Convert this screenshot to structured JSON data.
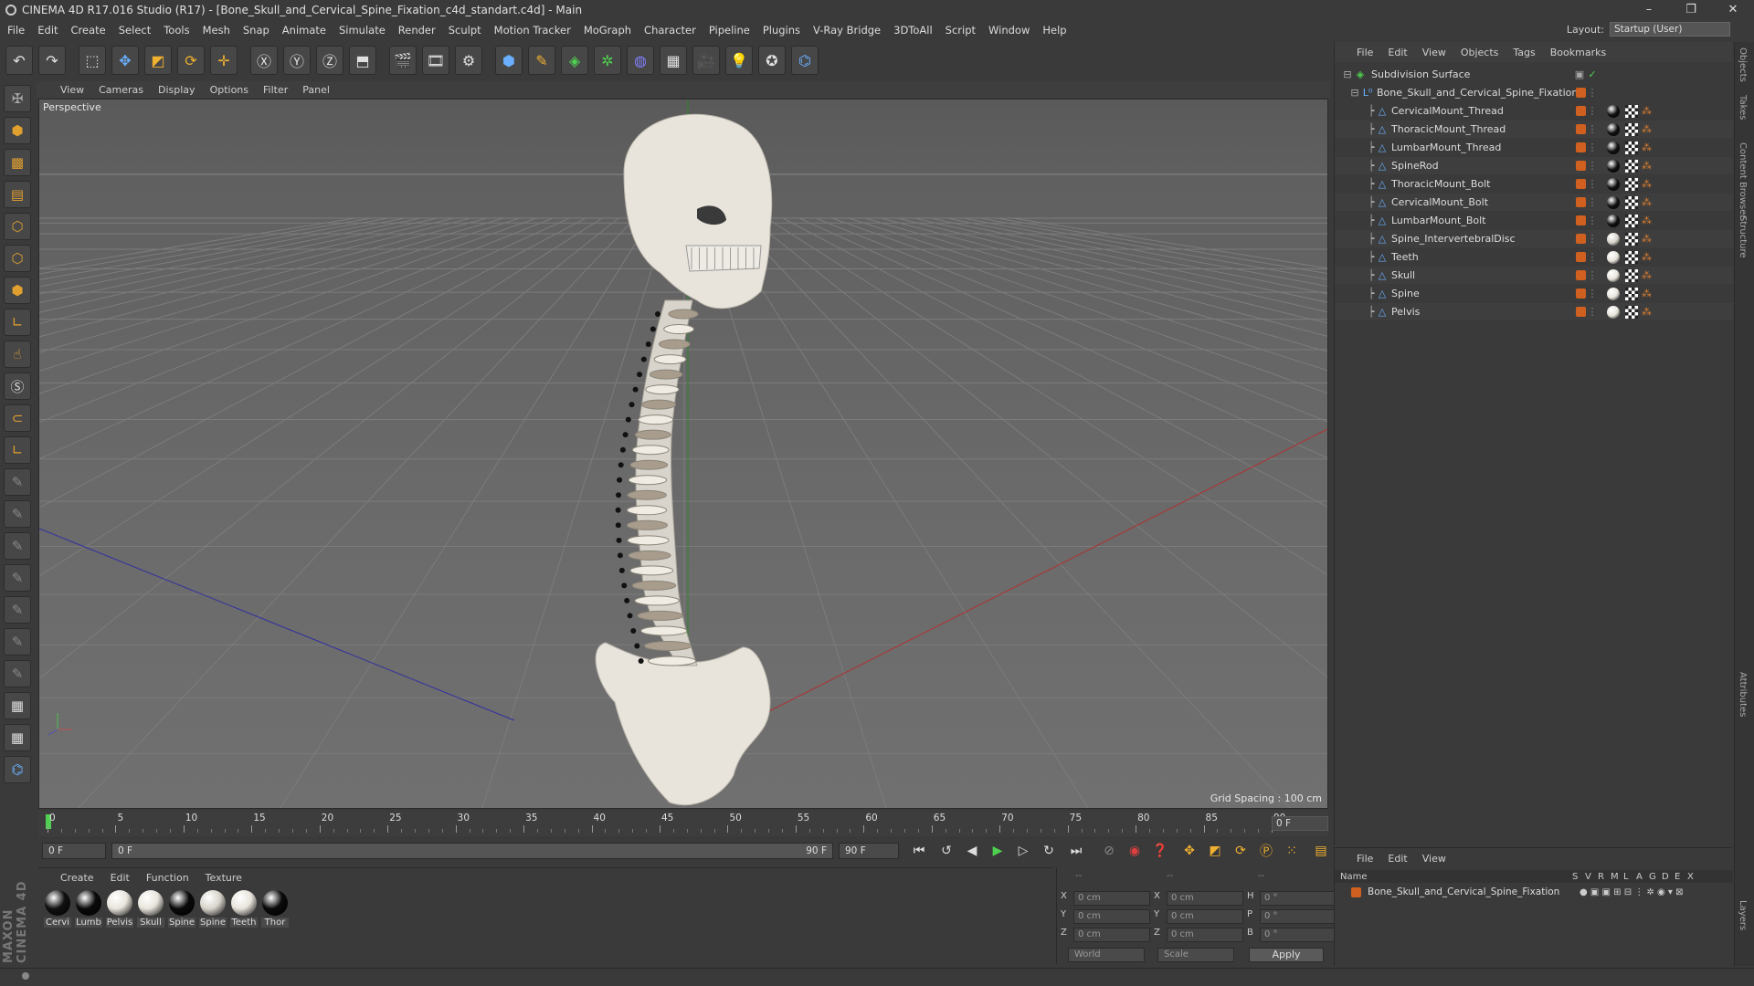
{
  "window": {
    "title": "CINEMA 4D R17.016 Studio (R17) - [Bone_Skull_and_Cervical_Spine_Fixation_c4d_standart.c4d] - Main",
    "controls": [
      "–",
      "❐",
      "✕"
    ]
  },
  "menubar": [
    "File",
    "Edit",
    "Create",
    "Select",
    "Tools",
    "Mesh",
    "Snap",
    "Animate",
    "Simulate",
    "Render",
    "Sculpt",
    "Motion Tracker",
    "MoGraph",
    "Character",
    "Pipeline",
    "Plugins",
    "V-Ray Bridge",
    "3DToAll",
    "Script",
    "Window",
    "Help"
  ],
  "layout": {
    "label": "Layout:",
    "value": "Startup (User)"
  },
  "viewport": {
    "menu": [
      "View",
      "Cameras",
      "Display",
      "Options",
      "Filter",
      "Panel"
    ],
    "label": "Perspective",
    "grid_spacing": "Grid Spacing : 100 cm"
  },
  "timeline": {
    "ticks": [
      "0",
      "5",
      "10",
      "15",
      "20",
      "25",
      "30",
      "35",
      "40",
      "45",
      "50",
      "55",
      "60",
      "65",
      "70",
      "75",
      "80",
      "85",
      "90"
    ],
    "current_frame": "0 F"
  },
  "transport": {
    "start_field": "0 F",
    "range_start": "0 F",
    "range_end": "90 F",
    "end_field": "90 F"
  },
  "materials": {
    "menu": [
      "Create",
      "Edit",
      "Function",
      "Texture"
    ],
    "items": [
      {
        "label": "Cervi",
        "color": "#111111"
      },
      {
        "label": "Lumb",
        "color": "#0a0a0a"
      },
      {
        "label": "Pelvis",
        "color": "#e8e4dc"
      },
      {
        "label": "Skull",
        "color": "#e8e4dc"
      },
      {
        "label": "Spine",
        "color": "#0a0a0a"
      },
      {
        "label": "Spine",
        "color": "#d8d4cc"
      },
      {
        "label": "Teeth",
        "color": "#e8e4dc"
      },
      {
        "label": "Thor",
        "color": "#0a0a0a"
      }
    ]
  },
  "coords": {
    "header": [
      "--",
      "--",
      "--"
    ],
    "rows": [
      {
        "a": "X",
        "av": "0 cm",
        "b": "X",
        "bv": "0 cm",
        "c": "H",
        "cv": "0 °"
      },
      {
        "a": "Y",
        "av": "0 cm",
        "b": "Y",
        "bv": "0 cm",
        "c": "P",
        "cv": "0 °"
      },
      {
        "a": "Z",
        "av": "0 cm",
        "b": "Z",
        "bv": "0 cm",
        "c": "B",
        "cv": "0 °"
      }
    ],
    "mode1": "World",
    "mode2": "Scale",
    "apply": "Apply"
  },
  "objects": {
    "menu": [
      "File",
      "Edit",
      "View",
      "Objects",
      "Tags",
      "Bookmarks"
    ],
    "root": "Subdivision Surface",
    "group": "Bone_Skull_and_Cervical_Spine_Fixation",
    "items": [
      {
        "name": "CervicalMount_Thread",
        "tag": "#111111"
      },
      {
        "name": "ThoracicMount_Thread",
        "tag": "#111111"
      },
      {
        "name": "LumbarMount_Thread",
        "tag": "#111111"
      },
      {
        "name": "SpineRod",
        "tag": "#111111"
      },
      {
        "name": "ThoracicMount_Bolt",
        "tag": "#111111"
      },
      {
        "name": "CervicalMount_Bolt",
        "tag": "#111111"
      },
      {
        "name": "LumbarMount_Bolt",
        "tag": "#111111"
      },
      {
        "name": "Spine_IntervertebralDisc",
        "tag": "#d8d4cc"
      },
      {
        "name": "Teeth",
        "tag": "#e8e4dc"
      },
      {
        "name": "Skull",
        "tag": "#e8e4dc"
      },
      {
        "name": "Spine",
        "tag": "#e8e4dc"
      },
      {
        "name": "Pelvis",
        "tag": "#e8e4dc"
      }
    ]
  },
  "attributes": {
    "menu": [
      "File",
      "Edit",
      "View"
    ],
    "columns": [
      "Name",
      "S",
      "V",
      "R",
      "M",
      "L",
      "A",
      "G",
      "D",
      "E",
      "X"
    ],
    "row": "Bone_Skull_and_Cervical_Spine_Fixation"
  },
  "right_tabs": [
    "Objects",
    "Takes",
    "Content Browser",
    "Structure",
    "Attributes",
    "Layers"
  ],
  "colors": {
    "accent": "#d06020",
    "bone": "#e8e4dc"
  }
}
